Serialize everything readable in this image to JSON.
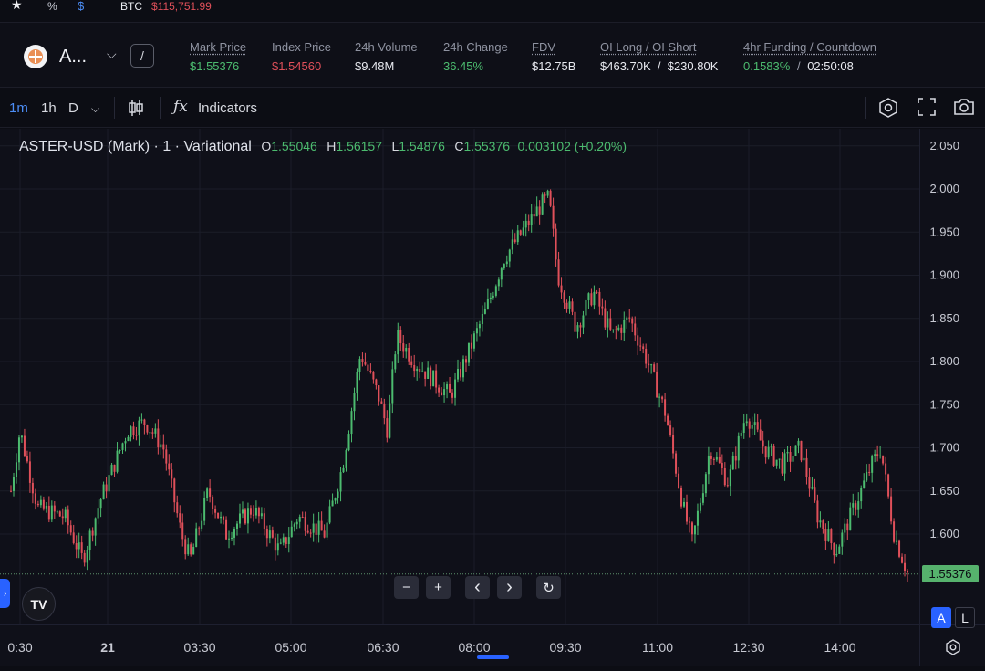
{
  "topbar": {
    "star": "★",
    "percent": "%",
    "dollar": "$",
    "btc_label": "BTC",
    "btc_price": "$115,751.99"
  },
  "market": {
    "symbol": "A...",
    "slash": "/",
    "stats": [
      {
        "label": "Mark Price",
        "value": "$1.55376",
        "color": "green"
      },
      {
        "label": "Index Price",
        "value": "$1.54560",
        "color": "red"
      },
      {
        "label": "24h Volume",
        "value": "$9.48M",
        "color": ""
      },
      {
        "label": "24h Change",
        "value": "36.45%",
        "color": "green"
      },
      {
        "label": "FDV",
        "value": "$12.75B",
        "color": ""
      },
      {
        "label": "OI Long / OI Short",
        "value": "$463.70K  /  $230.80K",
        "color": ""
      },
      {
        "label": "4hr Funding / Countdown",
        "value_a": "0.1583%",
        "value_sep": "/",
        "value_b": "02:50:08",
        "color": "green"
      }
    ]
  },
  "toolbar": {
    "tf_1m": "1m",
    "tf_1h": "1h",
    "tf_d": "D",
    "fx": "ƒx",
    "indicators": "Indicators"
  },
  "legend": {
    "title": "ASTER-USD (Mark) · 1 · Variational",
    "o_label": "O",
    "o_value": "1.55046",
    "h_label": "H",
    "h_value": "1.56157",
    "l_label": "L",
    "l_value": "1.54876",
    "c_label": "C",
    "c_value": "1.55376",
    "change": "0.003102 (+0.20%)"
  },
  "controls": {
    "minus": "−",
    "plus": "+",
    "left": "‹",
    "right": "›",
    "reset": "↻"
  },
  "price_tag": "1.55376",
  "scale_buttons": {
    "auto": "A",
    "log": "L"
  },
  "tv_logo": "TV",
  "colors": {
    "up": "#4cbb6f",
    "down": "#e0505a",
    "accent": "#2962ff"
  },
  "chart_data": {
    "type": "candlestick",
    "title": "ASTER-USD (Mark) · 1 · Variational",
    "ylim": [
      1.5,
      2.06
    ],
    "y_ticks": [
      "2.050",
      "2.000",
      "1.950",
      "1.900",
      "1.850",
      "1.800",
      "1.750",
      "1.700",
      "1.650",
      "1.600"
    ],
    "x_ticks": [
      "0:30",
      "21",
      "03:30",
      "05:00",
      "06:30",
      "08:00",
      "09:30",
      "11:00",
      "12:30",
      "14:00"
    ],
    "price_path": [
      [
        0.0,
        1.65
      ],
      [
        0.01,
        1.72
      ],
      [
        0.03,
        1.63
      ],
      [
        0.06,
        1.62
      ],
      [
        0.08,
        1.57
      ],
      [
        0.1,
        1.64
      ],
      [
        0.13,
        1.72
      ],
      [
        0.15,
        1.73
      ],
      [
        0.17,
        1.7
      ],
      [
        0.19,
        1.6
      ],
      [
        0.2,
        1.57
      ],
      [
        0.22,
        1.65
      ],
      [
        0.24,
        1.6
      ],
      [
        0.27,
        1.63
      ],
      [
        0.3,
        1.58
      ],
      [
        0.32,
        1.62
      ],
      [
        0.35,
        1.6
      ],
      [
        0.37,
        1.68
      ],
      [
        0.39,
        1.81
      ],
      [
        0.41,
        1.76
      ],
      [
        0.42,
        1.72
      ],
      [
        0.43,
        1.83
      ],
      [
        0.45,
        1.8
      ],
      [
        0.47,
        1.78
      ],
      [
        0.49,
        1.76
      ],
      [
        0.51,
        1.81
      ],
      [
        0.53,
        1.86
      ],
      [
        0.55,
        1.92
      ],
      [
        0.57,
        1.95
      ],
      [
        0.59,
        1.98
      ],
      [
        0.6,
        1.99
      ],
      [
        0.61,
        1.9
      ],
      [
        0.63,
        1.84
      ],
      [
        0.64,
        1.86
      ],
      [
        0.65,
        1.88
      ],
      [
        0.67,
        1.83
      ],
      [
        0.69,
        1.85
      ],
      [
        0.71,
        1.8
      ],
      [
        0.73,
        1.74
      ],
      [
        0.75,
        1.63
      ],
      [
        0.76,
        1.59
      ],
      [
        0.78,
        1.7
      ],
      [
        0.8,
        1.66
      ],
      [
        0.82,
        1.74
      ],
      [
        0.84,
        1.7
      ],
      [
        0.86,
        1.68
      ],
      [
        0.88,
        1.7
      ],
      [
        0.9,
        1.62
      ],
      [
        0.92,
        1.58
      ],
      [
        0.94,
        1.63
      ],
      [
        0.96,
        1.68
      ],
      [
        0.97,
        1.7
      ],
      [
        0.985,
        1.6
      ],
      [
        1.0,
        1.555
      ]
    ]
  }
}
